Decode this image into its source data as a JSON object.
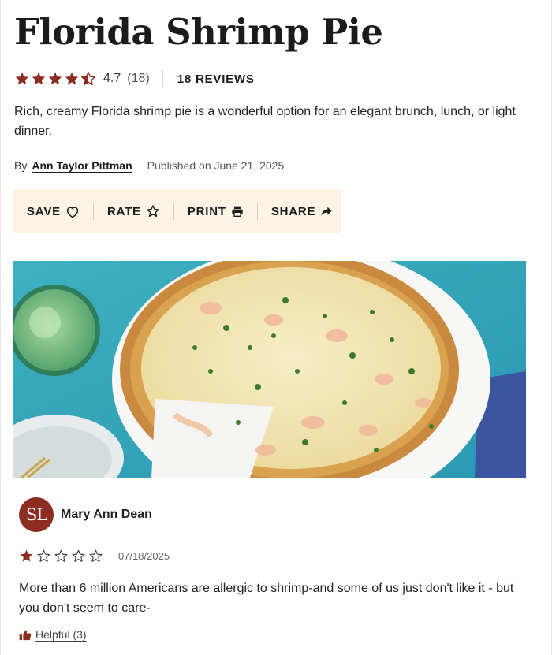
{
  "recipe": {
    "title": "Florida Shrimp Pie",
    "rating": {
      "value": 4.7,
      "value_label": "4.7",
      "count_label": "(18)",
      "stars_filled": 4.5,
      "reviews_label": "18 REVIEWS"
    },
    "description": "Rich, creamy Florida shrimp pie is a wonderful option for an elegant brunch, lunch, or light dinner.",
    "byline": {
      "by": "By",
      "author": "Ann Taylor Pittman",
      "published": "Published on June 21, 2025"
    },
    "actions": [
      {
        "label": "SAVE",
        "icon": "heart-icon"
      },
      {
        "label": "RATE",
        "icon": "star-outline-icon"
      },
      {
        "label": "PRINT",
        "icon": "printer-icon"
      },
      {
        "label": "SHARE",
        "icon": "share-arrow-icon"
      }
    ],
    "hero_image": {
      "alt": "shrimp pie in white dish"
    }
  },
  "review": {
    "avatar_initials": "SL",
    "reviewer_name": "Mary Ann Dean",
    "stars": 1,
    "stars_max": 5,
    "date": "07/18/2025",
    "text": "More than 6 million Americans are allergic to shrimp-and some of us just don't like it - but you don't seem to care-",
    "helpful_label": "Helpful (3)"
  },
  "colors": {
    "accent": "#8d2d21",
    "action_bar_bg": "#fbf3e4",
    "star_fill": "#8d2d21"
  }
}
